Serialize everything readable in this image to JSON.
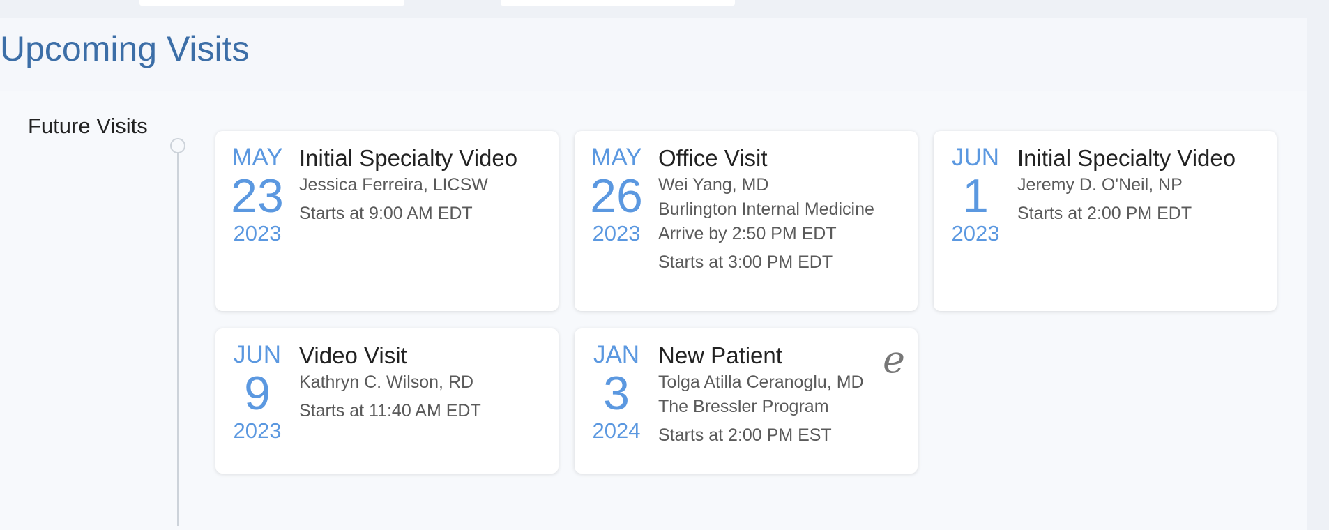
{
  "page": {
    "title": "Upcoming Visits",
    "group_label": "Future Visits"
  },
  "colors": {
    "title": "#3c6ea7",
    "date": "#5b98e0",
    "text": "#222222",
    "subtext": "#5a5a5a"
  },
  "visits": [
    {
      "month": "MAY",
      "day": "23",
      "year": "2023",
      "title": "Initial Specialty Video",
      "provider": "Jessica Ferreira, LICSW",
      "starts": "Starts at 9:00 AM EDT"
    },
    {
      "month": "MAY",
      "day": "26",
      "year": "2023",
      "title": "Office Visit",
      "provider": "Wei Yang, MD",
      "location": "Burlington Internal Medicine",
      "arrive": "Arrive by 2:50 PM EDT",
      "starts": "Starts at 3:00 PM EDT"
    },
    {
      "month": "JUN",
      "day": "1",
      "year": "2023",
      "title": "Initial Specialty Video",
      "provider": "Jeremy D. O'Neil, NP",
      "starts": "Starts at 2:00 PM EDT"
    },
    {
      "month": "JUN",
      "day": "9",
      "year": "2023",
      "title": "Video Visit",
      "provider": "Kathryn C. Wilson, RD",
      "starts": "Starts at 11:40 AM EDT"
    },
    {
      "month": "JAN",
      "day": "3",
      "year": "2024",
      "title": "New Patient",
      "provider": "Tolga Atilla Ceranoglu, MD",
      "location": "The Bressler Program",
      "starts": "Starts at 2:00 PM EST",
      "logo_icon": "external-organization-icon",
      "logo_glyph": "e"
    }
  ]
}
